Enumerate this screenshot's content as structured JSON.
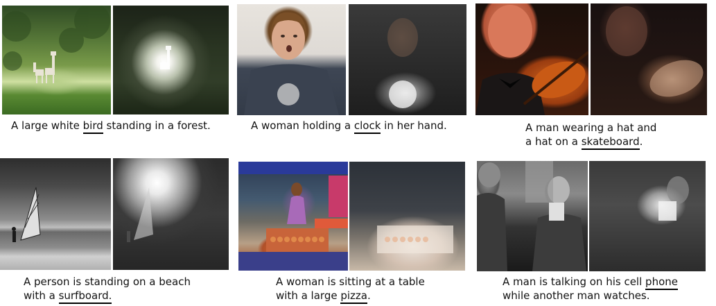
{
  "figure": {
    "panels": [
      {
        "id": "p1",
        "subject": "bird",
        "caption_lines": [
          [
            "A large white ",
            {
              "u": "bird"
            },
            " standing in a forest."
          ]
        ]
      },
      {
        "id": "p2",
        "subject": "clock",
        "caption_lines": [
          [
            "A woman holding a ",
            {
              "u": "clock"
            },
            " in her hand."
          ]
        ]
      },
      {
        "id": "p3",
        "subject": "skateboard",
        "caption_lines": [
          [
            "A man wearing a hat and"
          ],
          [
            "a hat on a ",
            {
              "u": "skateboard"
            },
            "."
          ]
        ]
      },
      {
        "id": "p4",
        "subject": "surfboard",
        "caption_lines": [
          [
            "A person is standing on a beach"
          ],
          [
            "with a ",
            {
              "u": "surfboard."
            }
          ]
        ]
      },
      {
        "id": "p5",
        "subject": "pizza",
        "caption_lines": [
          [
            "A woman is sitting at a table"
          ],
          [
            "with a large ",
            {
              "u": "pizza"
            },
            "."
          ]
        ]
      },
      {
        "id": "p6",
        "subject": "phone",
        "caption_lines": [
          [
            "A man is talking on his cell ",
            {
              "u": "phone"
            }
          ],
          [
            "while another man watches."
          ]
        ]
      }
    ],
    "colors": {
      "underline": "#000000",
      "text": "#111111",
      "background": "#ffffff"
    }
  }
}
